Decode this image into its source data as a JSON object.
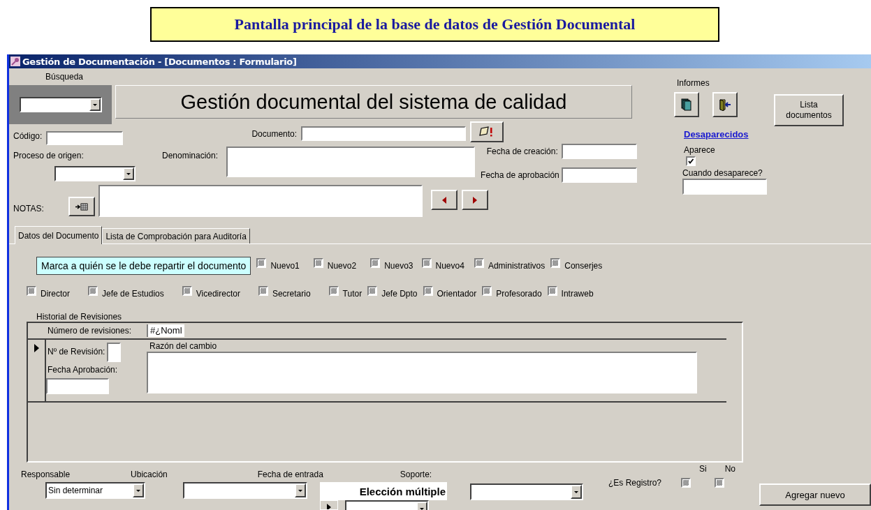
{
  "banner": {
    "title": "Pantalla principal de la base de datos de Gestión Documental"
  },
  "window": {
    "title": "Gestión de Documentación - [Documentos : Formulario]"
  },
  "search": {
    "label": "Búsqueda"
  },
  "form_title": "Gestión documental del sistema de calidad",
  "code": {
    "label": "Código:"
  },
  "document": {
    "label": "Documento:"
  },
  "origin_process": {
    "label": "Proceso de origen:"
  },
  "denomination": {
    "label": "Denominación:"
  },
  "creation_date": {
    "label": "Fecha de creación:"
  },
  "approval_date": {
    "label": "Fecha de aprobación"
  },
  "notes": {
    "label": "NOTAS:"
  },
  "reports": {
    "label": "Informes",
    "list_button": "Lista documentos"
  },
  "missing": {
    "link": "Desaparecidos",
    "appears_label": "Aparece",
    "appears_checked": true,
    "when_label": "Cuando desaparece?"
  },
  "tabs": [
    {
      "label": "Datos del Documento",
      "selected": true
    },
    {
      "label": "Lista de Comprobación para Auditoría",
      "selected": false
    }
  ],
  "distribution": {
    "hint": "Marca a quién se le debe repartir el documento",
    "recipient_rows": [
      [
        {
          "label": "Nuevo1",
          "indeterminate": true
        },
        {
          "label": "Nuevo2",
          "indeterminate": true
        },
        {
          "label": "Nuevo3",
          "indeterminate": true
        },
        {
          "label": "Nuevo4",
          "indeterminate": true
        },
        {
          "label": "Administrativos",
          "indeterminate": true
        },
        {
          "label": "Conserjes",
          "indeterminate": true
        }
      ],
      [
        {
          "label": "Director",
          "indeterminate": true
        },
        {
          "label": "Jefe de Estudios",
          "indeterminate": true
        },
        {
          "label": "Vicedirector",
          "indeterminate": true
        },
        {
          "label": "Secretario",
          "indeterminate": true
        },
        {
          "label": "Tutor",
          "indeterminate": true
        },
        {
          "label": "Jefe Dpto",
          "indeterminate": true
        },
        {
          "label": "Orientador",
          "indeterminate": true
        },
        {
          "label": "Profesorado",
          "indeterminate": true
        },
        {
          "label": "Intraweb",
          "indeterminate": true
        }
      ]
    ]
  },
  "revisions": {
    "title": "Historial de Revisiones",
    "count_label": "Número de revisiones:",
    "count_value": "#¿Noml",
    "number_label": "Nº de Revisión:",
    "reason_label": "Razón del cambio",
    "approval_label": "Fecha Aprobación:"
  },
  "bottom": {
    "responsible": {
      "label": "Responsable",
      "value": "Sin determinar"
    },
    "location": {
      "label": "Ubicación"
    },
    "entry_date": {
      "label": "Fecha de entrada"
    },
    "multiple_choice": {
      "label": "Elección múltiple"
    },
    "support": {
      "label": "Soporte:"
    },
    "is_record": {
      "label": "¿Es Registro?",
      "options": [
        {
          "label": "Si",
          "indeterminate": true
        },
        {
          "label": "No",
          "indeterminate": true
        }
      ]
    },
    "add_button": "Agregar nuevo"
  }
}
